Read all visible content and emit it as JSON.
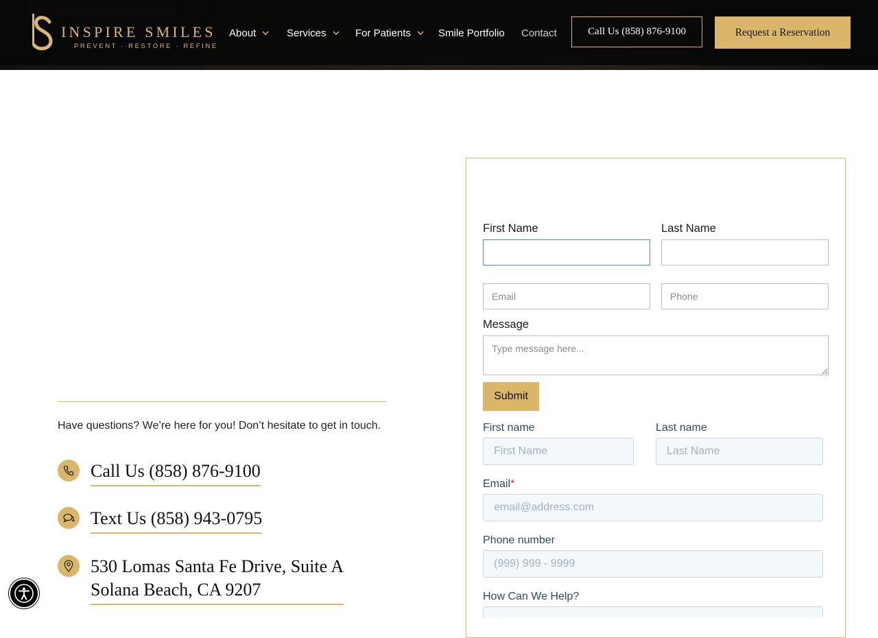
{
  "header": {
    "logo": {
      "wordmark": "INSPIRE SMILES",
      "tagline": "PREVENT · RESTORE · REFINE"
    },
    "nav": [
      {
        "label": "About",
        "dropdown": true
      },
      {
        "label": "Services",
        "dropdown": true
      },
      {
        "label": "For Patients",
        "dropdown": true
      },
      {
        "label": "Smile Portfolio",
        "dropdown": false
      },
      {
        "label": "Contact",
        "dropdown": false
      }
    ],
    "call_button": "Call Us (858) 876-9100",
    "reservation_button": "Request a Reservation"
  },
  "contact_info": {
    "intro": "Have questions? We’re here for you! Don’t hesitate to get in touch.",
    "phone": "Call Us (858) 876-9100",
    "text": "Text Us (858) 943-0795",
    "address_line1": "530 Lomas Santa Fe Drive, Suite A",
    "address_line2": "Solana Beach, CA 9207"
  },
  "form1": {
    "first_name_label": "First Name",
    "last_name_label": "Last Name",
    "first_name_value": "",
    "last_name_value": "",
    "email_placeholder": "Email",
    "phone_placeholder": "Phone",
    "message_label": "Message",
    "message_placeholder": "Type message here...",
    "submit_label": "Submit"
  },
  "form2": {
    "first_name_label": "First name",
    "first_name_placeholder": "First Name",
    "last_name_label": "Last name",
    "last_name_placeholder": "Last Name",
    "email_label": "Email",
    "required_mark": "*",
    "email_placeholder": "email@address.com",
    "phone_label": "Phone number",
    "phone_placeholder": "(999) 999 - 9999",
    "help_label": "How Can We Help?"
  },
  "colors": {
    "gold": "#d9b66a",
    "header_bg": "#0b0b0b",
    "focus_border": "#4a8ac4"
  }
}
